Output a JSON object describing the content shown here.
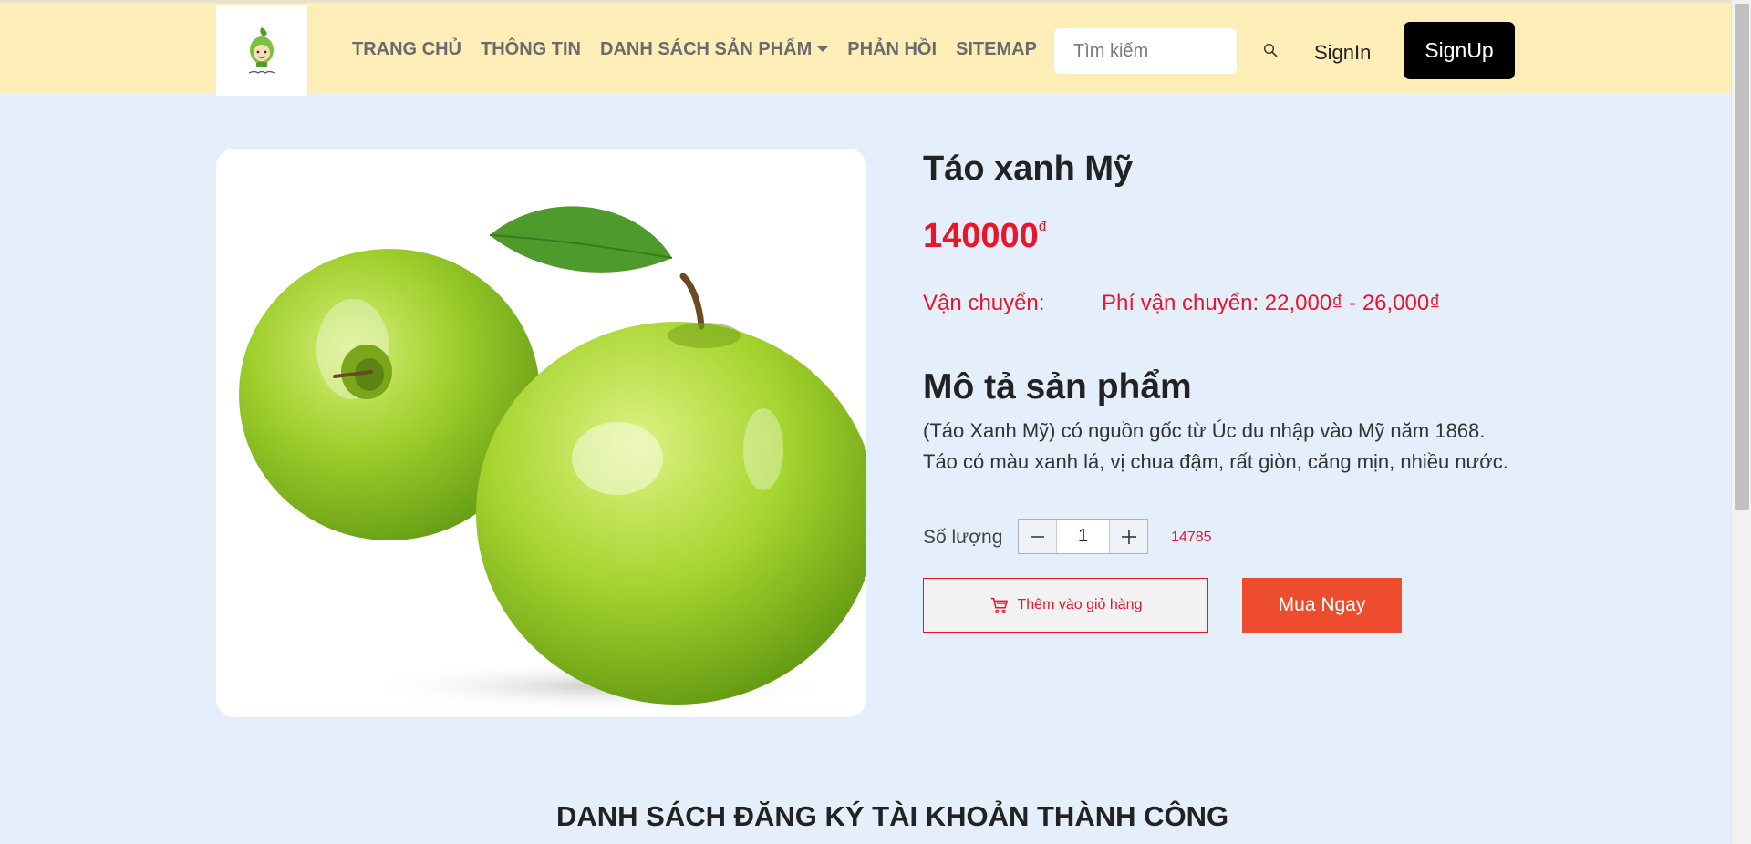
{
  "nav": {
    "items": [
      {
        "label": "TRANG CHỦ"
      },
      {
        "label": "THÔNG TIN"
      },
      {
        "label": "DANH SÁCH SẢN PHẨM"
      },
      {
        "label": "PHẢN HỒI"
      },
      {
        "label": "SITEMAP"
      }
    ],
    "search_placeholder": "Tìm kiếm",
    "signin_label": "SignIn",
    "signup_label": "SignUp"
  },
  "product": {
    "title": "Táo xanh Mỹ",
    "price": "140000",
    "currency_symbol": "đ",
    "shipping_label": "Vận chuyển:",
    "shipping_fee": "Phí vận chuyển: 22,000₫ - 26,000₫",
    "description_heading": "Mô tả sản phẩm",
    "description_line1": "(Táo Xanh Mỹ) có nguồn gốc từ Úc du nhập vào Mỹ năm 1868.",
    "description_line2": "Táo có màu xanh lá, vị chua đậm, rất giòn, căng mịn, nhiều nước.",
    "quantity_label": "Số lượng",
    "quantity_value": "1",
    "stock": "14785",
    "add_to_cart_label": "Thêm vào giỏ hàng",
    "buy_now_label": "Mua Ngay"
  },
  "section": {
    "heading": "DANH SÁCH ĐĂNG KÝ TÀI KHOẢN THÀNH CÔNG"
  },
  "icons": {
    "search": "search-icon",
    "cart": "cart-icon",
    "minus": "minus-icon",
    "plus": "plus-icon",
    "caret": "chevron-down-icon"
  },
  "colors": {
    "navbar_bg": "#fdeeb7",
    "page_bg": "#e5eefb",
    "price_red": "#e8152b",
    "buy_now_orange": "#ee4d2d",
    "signup_black": "#000000"
  }
}
